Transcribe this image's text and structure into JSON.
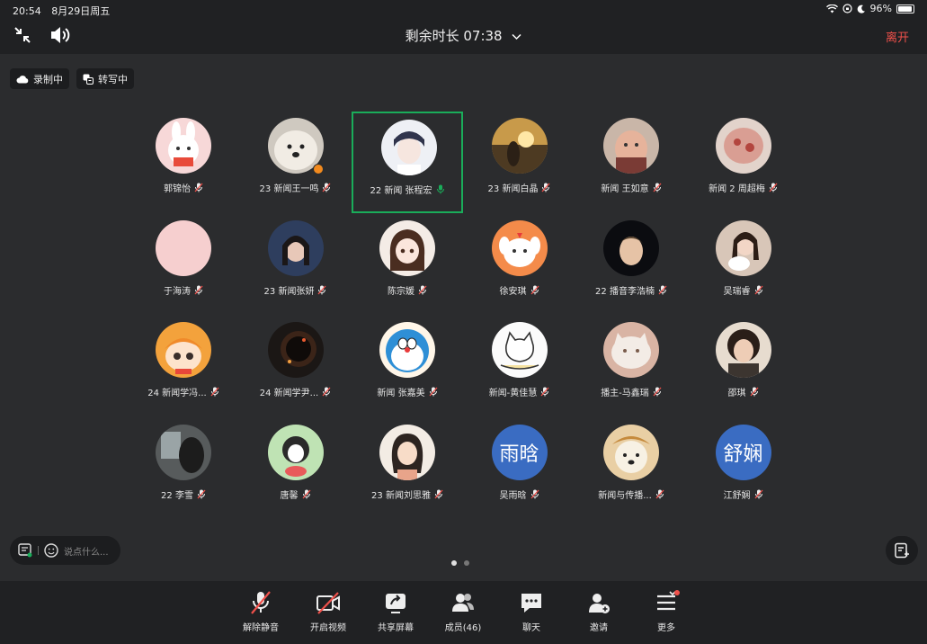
{
  "status": {
    "time": "20:54",
    "date": "8月29日周五",
    "battery": "96%",
    "battery_level": 0.96
  },
  "header": {
    "timer": "剩余时长 07:38",
    "leave": "离开"
  },
  "pills": {
    "recording": "录制中",
    "transcribing": "转写中"
  },
  "participants": [
    {
      "name": "郭锦怡",
      "avatar": "cartoon-bunny"
    },
    {
      "name": "23 新闻王一鸣",
      "avatar": "white-dog",
      "badge": true
    },
    {
      "name": "22 新闻 张程宏",
      "avatar": "anime-boy",
      "active": true,
      "speaking": true
    },
    {
      "name": "23 新闻白晶",
      "avatar": "sunset-photo"
    },
    {
      "name": "新闻 王如意",
      "avatar": "baby-photo"
    },
    {
      "name": "新闻 2 周超梅",
      "avatar": "red-blob"
    },
    {
      "name": "于海涛",
      "avatar": "pink-plain"
    },
    {
      "name": "23 新闻张妍",
      "avatar": "girl-photo"
    },
    {
      "name": "陈宗媛",
      "avatar": "anime-girl"
    },
    {
      "name": "徐安琪",
      "avatar": "cartoon-dog"
    },
    {
      "name": "22 播音李浩楠",
      "avatar": "boy-photo"
    },
    {
      "name": "吴瑞睿",
      "avatar": "girl-cat-photo"
    },
    {
      "name": "24 新闻学冯...",
      "avatar": "anime-orange"
    },
    {
      "name": "24 新闻学尹...",
      "avatar": "dark-photo"
    },
    {
      "name": "新闻 张嘉美",
      "avatar": "doraemon"
    },
    {
      "name": "新闻-黄佳慧",
      "avatar": "sketch-cat"
    },
    {
      "name": "播主-马鑫瑞",
      "avatar": "cat-photo"
    },
    {
      "name": "邵琪",
      "avatar": "curly-girl"
    },
    {
      "name": "22 李雪",
      "avatar": "window-photo"
    },
    {
      "name": "唐馨",
      "avatar": "green-drawing"
    },
    {
      "name": "23 新闻刘思雅",
      "avatar": "cartoon-girl"
    },
    {
      "name": "吴雨晗",
      "avatar_text": "雨晗"
    },
    {
      "name": "新闻与传播...",
      "avatar": "puppy-photo"
    },
    {
      "name": "江舒娴",
      "avatar_text": "舒娴"
    }
  ],
  "chat": {
    "placeholder": "说点什么..."
  },
  "toolbar": [
    {
      "label": "解除静音",
      "icon": "mic-muted-icon"
    },
    {
      "label": "开启视频",
      "icon": "video-off-icon"
    },
    {
      "label": "共享屏幕",
      "icon": "share-screen-icon"
    },
    {
      "label": "成员(46)",
      "icon": "members-icon"
    },
    {
      "label": "聊天",
      "icon": "chat-icon"
    },
    {
      "label": "邀请",
      "icon": "invite-icon"
    },
    {
      "label": "更多",
      "icon": "more-icon"
    }
  ],
  "colors": {
    "accent_green": "#1aad5a",
    "leave_red": "#f0514b",
    "text_avatar": "#3a6cc2"
  }
}
